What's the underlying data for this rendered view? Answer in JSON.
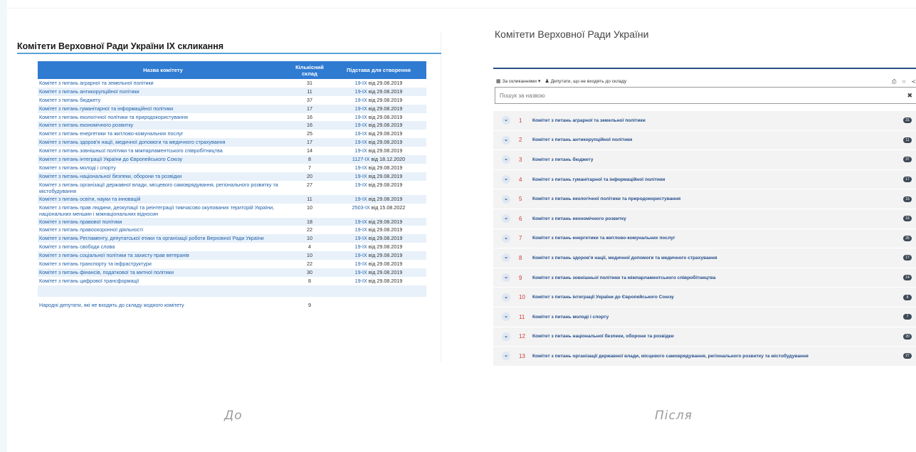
{
  "before": {
    "title": "Комітети Верховної Ради України IX скликання",
    "headers": {
      "name": "Назва комітету",
      "count": "Кількісний склад",
      "basis": "Підстава для створення"
    },
    "rows": [
      {
        "name": "Комітет з питань аграрної та земельної політики",
        "count": "31",
        "link": "19-IX",
        "date": "від 29.08.2019"
      },
      {
        "name": "Комітет з питань антикорупційної політики",
        "count": "11",
        "link": "19-IX",
        "date": "від 29.08.2019"
      },
      {
        "name": "Комітет з питань бюджету",
        "count": "37",
        "link": "19-IX",
        "date": "від 29.08.2019"
      },
      {
        "name": "Комітет з питань гуманітарної та інформаційної політики",
        "count": "17",
        "link": "19-IX",
        "date": "від 29.08.2019"
      },
      {
        "name": "Комітет з питань екологічної політики та природокористування",
        "count": "16",
        "link": "19-IX",
        "date": "від 29.08.2019"
      },
      {
        "name": "Комітет з питань економічного розвитку",
        "count": "16",
        "link": "19-IX",
        "date": "від 29.08.2019"
      },
      {
        "name": "Комітет з питань енергетики та житлово-комунальних послуг",
        "count": "25",
        "link": "19-IX",
        "date": "від 29.08.2019"
      },
      {
        "name": "Комітет з питань здоров'я нації, медичної допомоги та медичного страхування",
        "count": "17",
        "link": "19-IX",
        "date": "від 29.08.2019"
      },
      {
        "name": "Комітет з питань зовнішньої політики та міжпарламентського співробітництва",
        "count": "14",
        "link": "19-IX",
        "date": "від 29.08.2019"
      },
      {
        "name": "Комітет з питань інтеграції України до Європейського Союзу",
        "count": "8",
        "link": "1127-IX",
        "date": "від 18.12.2020"
      },
      {
        "name": "Комітет з питань молоді і спорту",
        "count": "7",
        "link": "19-IX",
        "date": "від 29.08.2019"
      },
      {
        "name": "Комітет з питань національної безпеки, оборони та розвідки",
        "count": "20",
        "link": "19-IX",
        "date": "від 29.08.2019"
      },
      {
        "name": "Комітет з питань організації державної влади, місцевого самоврядування, регіонального розвитку та містобудування",
        "count": "27",
        "link": "19-IX",
        "date": "від 29.08.2019"
      },
      {
        "name": "Комітет з питань освіти, науки та інновацій",
        "count": "11",
        "link": "19-IX",
        "date": "від 29.08.2019"
      },
      {
        "name": "Комітет з питань прав людини, деокупації та реінтеграції тимчасово окупованих територій України, національних меншин і міжнаціональних відносин",
        "count": "10",
        "link": "2503-IX",
        "date": "від 15.08.2022"
      },
      {
        "name": "Комітет з питань правової політики",
        "count": "18",
        "link": "19-IX",
        "date": "від 29.08.2019"
      },
      {
        "name": "Комітет з питань правоохоронної діяльності",
        "count": "22",
        "link": "19-IX",
        "date": "від 29.08.2019"
      },
      {
        "name": "Комітет з питань Регламенту, депутатської етики та організації роботи Верховної Ради України",
        "count": "10",
        "link": "19-IX",
        "date": "від 29.08.2019"
      },
      {
        "name": "Комітет з питань свободи слова",
        "count": "4",
        "link": "19-IX",
        "date": "від 29.08.2019"
      },
      {
        "name": "Комітет з питань соціальної політики та захисту прав ветеранів",
        "count": "10",
        "link": "19-IX",
        "date": "від 29.08.2019"
      },
      {
        "name": "Комітет з питань транспорту та інфраструктури",
        "count": "22",
        "link": "19-IX",
        "date": "від 29.08.2019"
      },
      {
        "name": "Комітет з питань фінансів, податкової та митної політики",
        "count": "30",
        "link": "19-IX",
        "date": "від 29.08.2019"
      },
      {
        "name": "Комітет з питань цифрової трансформації",
        "count": "8",
        "link": "19-IX",
        "date": "від 29.08.2019"
      }
    ],
    "final": {
      "name": "Народні депутати, які не входять до складу жодного комітету",
      "count": "9"
    },
    "caption": "До"
  },
  "after": {
    "title": "Комітети Верховної Ради України",
    "toolbar": {
      "convocations": "За скликаннями",
      "deputies": "Депутати, що не входять до складу"
    },
    "search_placeholder": "Пошук за назвою",
    "items": [
      {
        "num": "1",
        "name": "Комітет з питань аграрної та земельної політики",
        "badge": "31"
      },
      {
        "num": "2",
        "name": "Комітет з питань антикорупційної політики",
        "badge": "11"
      },
      {
        "num": "3",
        "name": "Комітет з питань бюджету",
        "badge": "37"
      },
      {
        "num": "4",
        "name": "Комітет з питань гуманітарної та інформаційної політики",
        "badge": "17"
      },
      {
        "num": "5",
        "name": "Комітет з питань екологічної політики та природокористування",
        "badge": "16"
      },
      {
        "num": "6",
        "name": "Комітет з питань економічного розвитку",
        "badge": "16"
      },
      {
        "num": "7",
        "name": "Комітет з питань енергетики та житлово-комунальних послуг",
        "badge": "25"
      },
      {
        "num": "8",
        "name": "Комітет з питань здоров'я нації, медичної допомоги та медичного страхування",
        "badge": "17"
      },
      {
        "num": "9",
        "name": "Комітет з питань зовнішньої політики та міжпарламентського співробітництва",
        "badge": "14"
      },
      {
        "num": "10",
        "name": "Комітет з питань інтеграції України до Європейського Союзу",
        "badge": "8"
      },
      {
        "num": "11",
        "name": "Комітет з питань молоді і спорту",
        "badge": "7"
      },
      {
        "num": "12",
        "name": "Комітет з питань національної безпеки, оборони та розвідки",
        "badge": "20"
      },
      {
        "num": "13",
        "name": "Комітет з питань організації державної влади, місцевого самоврядування, регіонального розвитку та містобудування",
        "badge": "27"
      }
    ],
    "caption": "Після"
  },
  "colors": {
    "header_blue": "#2f7bd2",
    "link_blue": "#1f5fa8",
    "dark_navy": "#2c4e86",
    "number_red": "#d43a3a"
  },
  "icons": {
    "calendar": "calendar-icon",
    "users": "users-icon",
    "chevron": "chevron-down-icon",
    "close": "close-icon",
    "print": "print-icon",
    "refresh": "refresh-icon",
    "share": "share-icon"
  }
}
